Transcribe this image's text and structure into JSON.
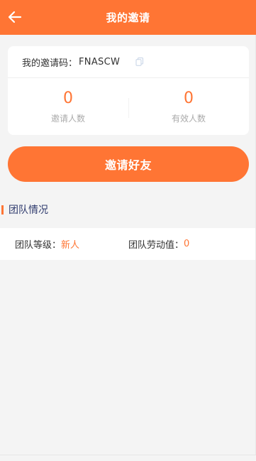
{
  "header": {
    "title": "我的邀请",
    "back_icon": "arrow-left-icon"
  },
  "invite_card": {
    "code_label": "我的邀请码：",
    "code_value": "FNASCW",
    "copy_icon": "copy-icon",
    "stats": [
      {
        "value": "0",
        "label": "邀请人数"
      },
      {
        "value": "0",
        "label": "有效人数"
      }
    ]
  },
  "invite_button": {
    "label": "邀请好友"
  },
  "team_section": {
    "title": "团队情况",
    "level_label": "团队等级：",
    "level_value": "新人",
    "labor_label": "团队劳动值：",
    "labor_value": "0"
  },
  "colors": {
    "accent": "#ff7534",
    "background": "#f4f4f4",
    "section_title": "#2f3b6e"
  }
}
